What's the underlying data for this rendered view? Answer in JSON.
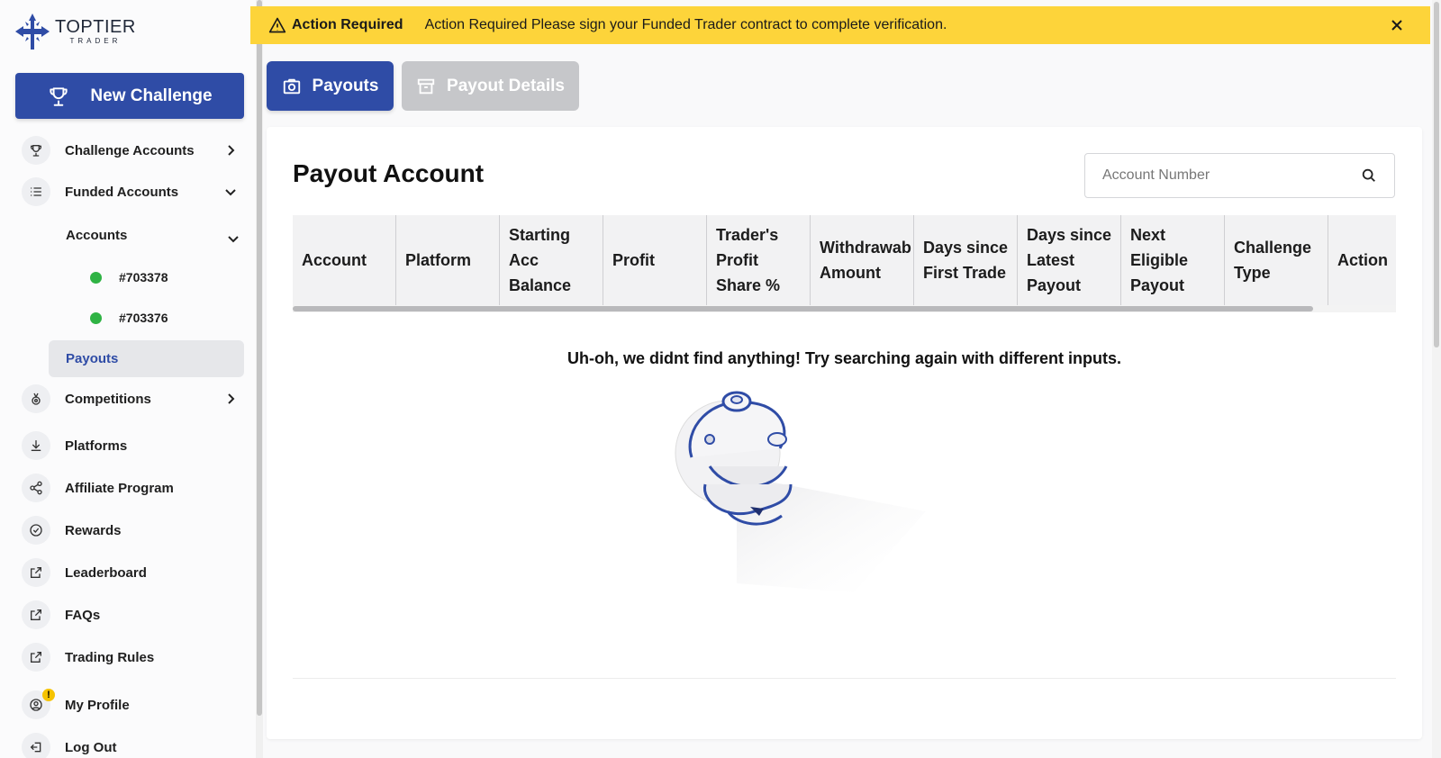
{
  "brand": {
    "name": "TOPTIER",
    "sub": "TRADER"
  },
  "sidebar": {
    "new_challenge": "New Challenge",
    "challenge_accounts": "Challenge Accounts",
    "funded_accounts": "Funded Accounts",
    "accounts": "Accounts",
    "account_list": [
      {
        "id": "#703378",
        "status": "active"
      },
      {
        "id": "#703376",
        "status": "active"
      }
    ],
    "payouts": "Payouts",
    "competitions": "Competitions",
    "platforms": "Platforms",
    "affiliate_program": "Affiliate Program",
    "rewards": "Rewards",
    "leaderboard": "Leaderboard",
    "faqs": "FAQs",
    "trading_rules": "Trading Rules",
    "my_profile": "My Profile",
    "profile_badge": "!",
    "log_out": "Log Out"
  },
  "alert": {
    "title": "Action Required",
    "message": "Action Required Please sign your Funded Trader contract to complete verification."
  },
  "tabs": {
    "payouts": "Payouts",
    "payout_details": "Payout Details"
  },
  "card": {
    "title": "Payout Account",
    "search_placeholder": "Account Number",
    "columns": [
      [
        "Account"
      ],
      [
        "Platform"
      ],
      [
        "Starting",
        "Acc",
        "Balance"
      ],
      [
        "Profit"
      ],
      [
        "Trader's",
        "Profit",
        "Share %"
      ],
      [
        "Withdrawab",
        "Amount"
      ],
      [
        "Days since",
        "First Trade"
      ],
      [
        "Days since",
        "Latest",
        "Payout"
      ],
      [
        "Next",
        "Eligible",
        "Payout"
      ],
      [
        "Challenge",
        "Type"
      ],
      [
        "Action"
      ]
    ],
    "empty_message": "Uh-oh, we didnt find anything! Try searching again with different inputs."
  },
  "colors": {
    "primary": "#2f4ca6",
    "alert": "#fdd43a",
    "status_active": "#2fb344",
    "tab_inactive": "#c6c7ca"
  }
}
